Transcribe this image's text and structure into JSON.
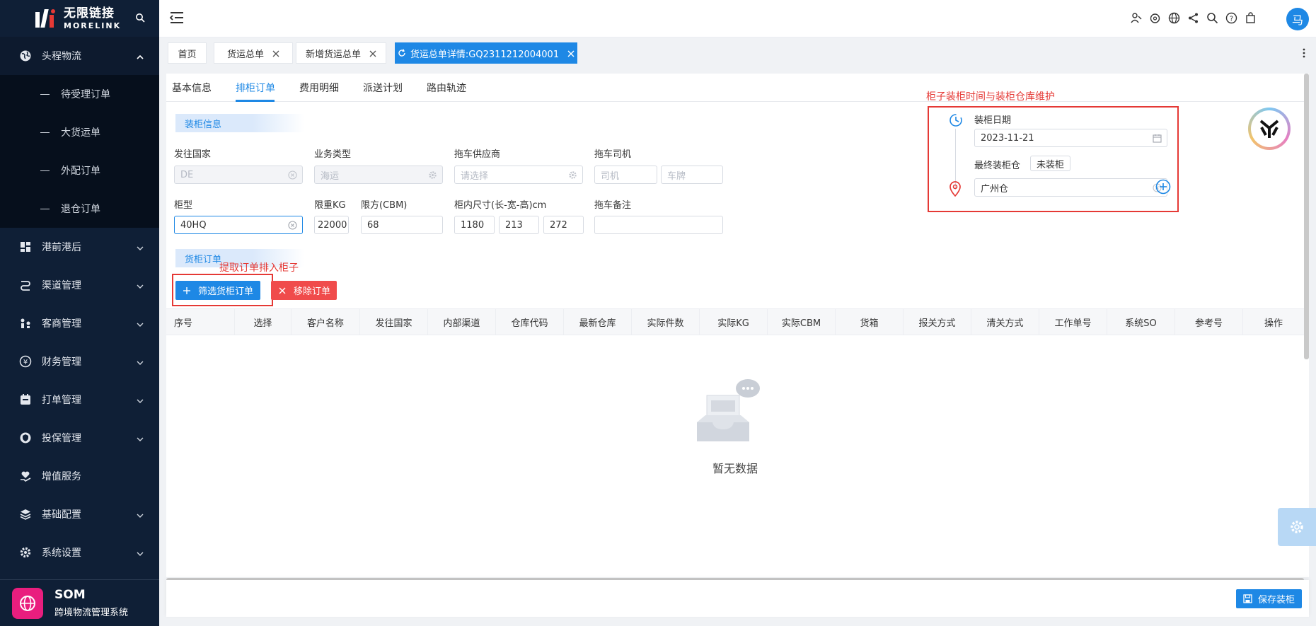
{
  "brand": {
    "name_cn": "无限链接",
    "name_en": "MORELINK"
  },
  "sidebar": {
    "items": [
      {
        "label": "头程物流",
        "icon": "globe-icon",
        "open": true,
        "children": [
          "待受理订单",
          "大货运单",
          "外配订单",
          "退仓订单"
        ]
      },
      {
        "label": "港前港后",
        "icon": "dashboard-icon"
      },
      {
        "label": "渠道管理",
        "icon": "route-icon"
      },
      {
        "label": "客商管理",
        "icon": "people-icon"
      },
      {
        "label": "财务管理",
        "icon": "yen-icon"
      },
      {
        "label": "打单管理",
        "icon": "print-icon"
      },
      {
        "label": "投保管理",
        "icon": "shield-icon"
      },
      {
        "label": "增值服务",
        "icon": "heart-hand-icon"
      },
      {
        "label": "基础配置",
        "icon": "layers-icon"
      },
      {
        "label": "系统设置",
        "icon": "gear-icon"
      }
    ],
    "footer": {
      "title": "SOM",
      "subtitle": "跨境物流管理系统"
    }
  },
  "header": {
    "avatar_text": "马"
  },
  "page_tabs": [
    {
      "label": "首页"
    },
    {
      "label": "货运总单"
    },
    {
      "label": "新增货运总单"
    },
    {
      "label": "货运总单详情:GQ2311212004001"
    }
  ],
  "sub_tabs": [
    "基本信息",
    "排柜订单",
    "费用明细",
    "派送计划",
    "路由轨迹"
  ],
  "container_info": {
    "section_title": "装柜信息",
    "fields": {
      "dest_country": {
        "label": "发往国家",
        "value": "DE"
      },
      "business_type": {
        "label": "业务类型",
        "value": "海运"
      },
      "truck_supplier": {
        "label": "拖车供应商",
        "placeholder": "请选择"
      },
      "truck_driver": {
        "label": "拖车司机",
        "driver_placeholder": "司机",
        "plate_placeholder": "车牌"
      },
      "container_type": {
        "label": "柜型",
        "value": "40HQ"
      },
      "weight_limit": {
        "label": "限重KG",
        "value": "22000"
      },
      "volume_limit": {
        "label": "限方(CBM)",
        "value": "68"
      },
      "inner_size": {
        "label": "柜内尺寸(长-宽-高)cm",
        "length": "1180",
        "width": "213",
        "height": "272"
      },
      "truck_note": {
        "label": "拖车备注",
        "value": ""
      }
    }
  },
  "orders_section": {
    "title": "货柜订单",
    "annotation": "提取订单排入柜子",
    "filter_button": "筛选货柜订单",
    "remove_button": "移除订单",
    "columns": [
      "序号",
      "选择",
      "客户名称",
      "发往国家",
      "内部渠道",
      "仓库代码",
      "最新仓库",
      "实际件数",
      "实际KG",
      "实际CBM",
      "货箱",
      "报关方式",
      "清关方式",
      "工作单号",
      "系统SO",
      "参考号",
      "操作"
    ],
    "empty_text": "暂无数据"
  },
  "loading_panel": {
    "annotation": "柜子装柜时间与装柜仓库维护",
    "date_label": "装柜日期",
    "date_value": "2023-11-21",
    "final_wh_label": "最终装柜仓",
    "status_tag": "未装柜",
    "warehouse_value": "广州仓"
  },
  "footer_bar": {
    "save_button": "保存装柜"
  },
  "colors": {
    "primary": "#1e88e5",
    "danger": "#f04b4b",
    "sidebar_bg": "#0f1f36",
    "annotation": "#e53935"
  }
}
